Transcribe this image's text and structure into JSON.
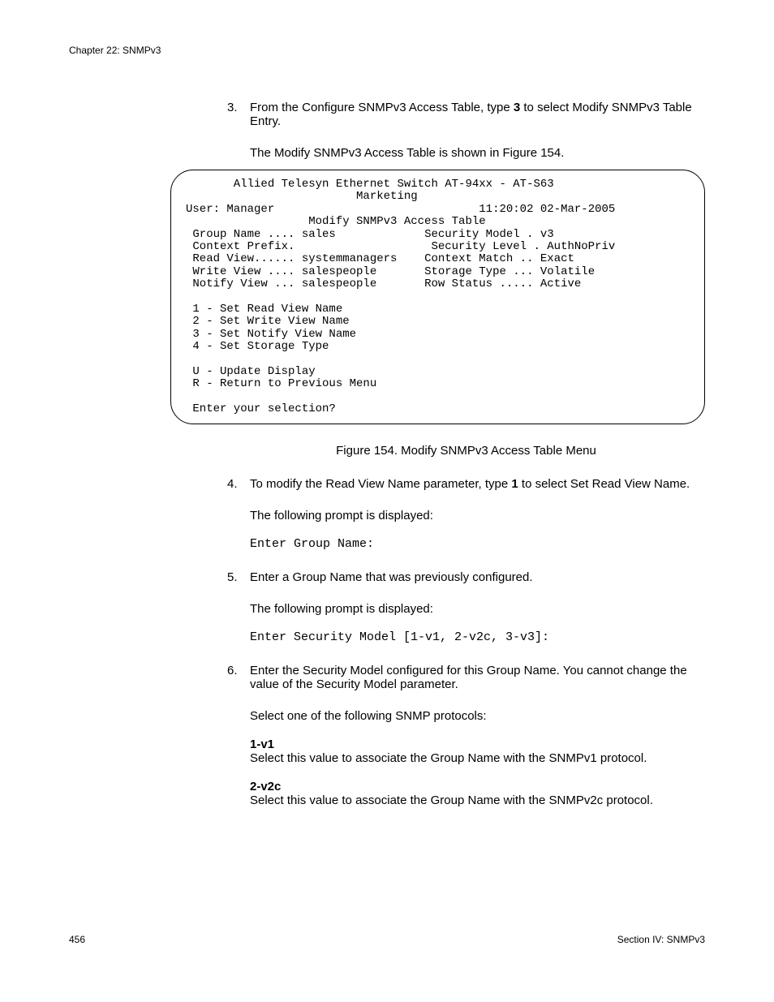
{
  "header": {
    "chapter": "Chapter 22: SNMPv3"
  },
  "steps": {
    "s3": {
      "num": "3.",
      "text_a": "From the Configure SNMPv3 Access Table, type ",
      "bold_a": "3",
      "text_b": " to select Modify SNMPv3 Table Entry.",
      "follow": "The Modify SNMPv3 Access Table is shown in Figure 154."
    },
    "s4": {
      "num": "4.",
      "text_a": "To modify the Read View Name parameter, type ",
      "bold_a": "1",
      "text_b": " to select Set Read View Name.",
      "follow": "The following prompt is displayed:",
      "prompt": "Enter Group Name:"
    },
    "s5": {
      "num": "5.",
      "text": "Enter a Group Name that was previously configured.",
      "follow": "The following prompt is displayed:",
      "prompt": "Enter Security Model [1-v1, 2-v2c, 3-v3]:"
    },
    "s6": {
      "num": "6.",
      "text": "Enter the Security Model configured for this Group Name. You cannot change the value of the Security Model parameter.",
      "follow": "Select one of the following SNMP protocols:",
      "opt1_head": "1-v1",
      "opt1_body": "Select this value to associate the Group Name with the SNMPv1 protocol.",
      "opt2_head": "2-v2c",
      "opt2_body": "Select this value to associate the Group Name with the SNMPv2c protocol."
    }
  },
  "terminal": {
    "line1": "       Allied Telesyn Ethernet Switch AT-94xx - AT-S63",
    "line2": "                         Marketing",
    "user_label": "User: Manager",
    "timestamp": "11:20:02 02-Mar-2005",
    "title": "                  Modify SNMPv3 Access Table",
    "row1l": " Group Name .... sales",
    "row1r": "Security Model . v3",
    "row2l": " Context Prefix.",
    "row2r": "Security Level . AuthNoPriv",
    "row3l": " Read View...... systemmanagers",
    "row3r": "Context Match .. Exact",
    "row4l": " Write View .... salespeople",
    "row4r": "Storage Type ... Volatile",
    "row5l": " Notify View ... salespeople",
    "row5r": "Row Status ..... Active",
    "m1": " 1 - Set Read View Name",
    "m2": " 2 - Set Write View Name",
    "m3": " 3 - Set Notify View Name",
    "m4": " 4 - Set Storage Type",
    "mu": " U - Update Display",
    "mr": " R - Return to Previous Menu",
    "sel": " Enter your selection?"
  },
  "figure": {
    "caption": "Figure 154. Modify SNMPv3 Access Table Menu"
  },
  "footer": {
    "page": "456",
    "section": "Section IV: SNMPv3"
  }
}
